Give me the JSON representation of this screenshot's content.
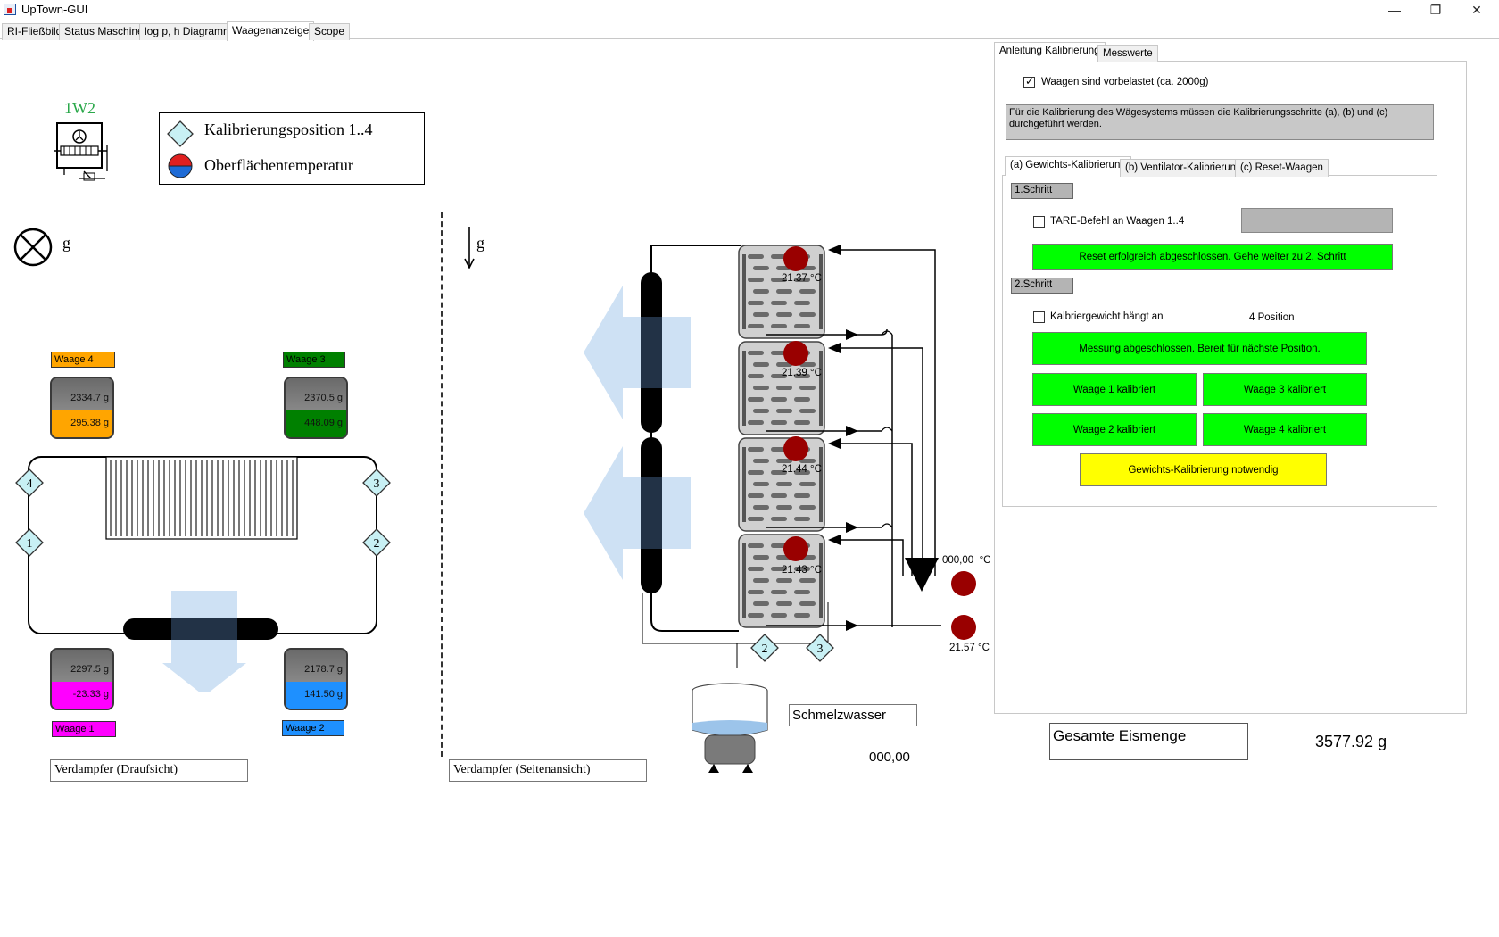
{
  "window": {
    "title": "UpTown-GUI",
    "controls": {
      "minimize": "—",
      "restore": "❐",
      "close": "✕"
    }
  },
  "main_tabs": [
    {
      "label": "RI-Fließbild"
    },
    {
      "label": "Status Maschine"
    },
    {
      "label": "log p, h Diagramm"
    },
    {
      "label": "Waagenanzeige",
      "active": true
    },
    {
      "label": "Scope"
    }
  ],
  "legend": {
    "unit_label": "1W2",
    "items": [
      {
        "label": "Kalibrierungsposition 1..4",
        "icon": "diamond-icon"
      },
      {
        "label": "Oberflächentemperatur",
        "icon": "temperature-dot-icon"
      }
    ]
  },
  "top_view": {
    "gravity_label": "g",
    "caption": "Verdampfer (Draufsicht)",
    "positions": [
      "1",
      "2",
      "3",
      "4"
    ],
    "scales": [
      {
        "name": "Waage 4",
        "total": "2334.7 g",
        "value": "295.38 g",
        "color": "#ffa500"
      },
      {
        "name": "Waage 3",
        "total": "2370.5 g",
        "value": "448.09 g",
        "color": "#008000"
      },
      {
        "name": "Waage 1",
        "total": "2297.5 g",
        "value": "-23.33 g",
        "color": "#ff00ff"
      },
      {
        "name": "Waage 2",
        "total": "2178.7 g",
        "value": "141.50 g",
        "color": "#1e90ff"
      }
    ]
  },
  "side_view": {
    "gravity_label": "g",
    "caption": "Verdampfer (Seitenansicht)",
    "temperatures": [
      {
        "value": "21.37",
        "unit": "°C"
      },
      {
        "value": "21.39",
        "unit": "°C"
      },
      {
        "value": "21.44",
        "unit": "°C"
      },
      {
        "value": "21.43",
        "unit": "°C"
      }
    ],
    "inlet_temp": {
      "value": "000,00",
      "unit": "°C"
    },
    "outlet_temp": {
      "value": "21.57",
      "unit": "°C"
    },
    "positions": [
      "2",
      "3"
    ],
    "meltwater_label": "Schmelzwasser",
    "meltwater_value": "000,00"
  },
  "total_ice": {
    "label": "Gesamte Eismenge",
    "value": "3577.92 g"
  },
  "right_panel": {
    "tabs": [
      {
        "label": "Anleitung Kalibrierung",
        "active": true
      },
      {
        "label": "Messwerte"
      }
    ],
    "preloaded_checkbox": {
      "label": "Waagen sind vorbelastet (ca. 2000g)",
      "checked": true
    },
    "info_text": "Für die Kalibrierung des Wägesystems müssen die Kalibrierungsschritte (a), (b) und (c) durchgeführt werden.",
    "sub_tabs": [
      {
        "label": "(a) Gewichts-Kalibrierung",
        "active": true
      },
      {
        "label": "(b) Ventilator-Kalibrierung"
      },
      {
        "label": "(c) Reset-Waagen"
      }
    ],
    "step1": {
      "label": "1.Schritt",
      "tare_checkbox": {
        "label": "TARE-Befehl an Waagen 1..4",
        "checked": false
      },
      "status": "Reset erfolgreich abgeschlossen.  Gehe weiter zu 2. Schritt"
    },
    "step2": {
      "label": "2.Schritt",
      "weight_checkbox": {
        "label": "Kalbriergewicht hängt an",
        "checked": false
      },
      "position_text": "4 Position",
      "status": "Messung abgeschlossen. Bereit für nächste Position.",
      "buttons": [
        "Waage 1 kalibriert",
        "Waage 3 kalibriert",
        "Waage 2 kalibriert",
        "Waage 4 kalibriert"
      ],
      "warning": "Gewichts-Kalibrierung notwendig"
    }
  },
  "colors": {
    "temp_dot": "#990000",
    "status_green": "#00ff00",
    "warning_yellow": "#ffff00",
    "airflow": "#c6dcf2",
    "diamond": "#c8f0f4"
  }
}
